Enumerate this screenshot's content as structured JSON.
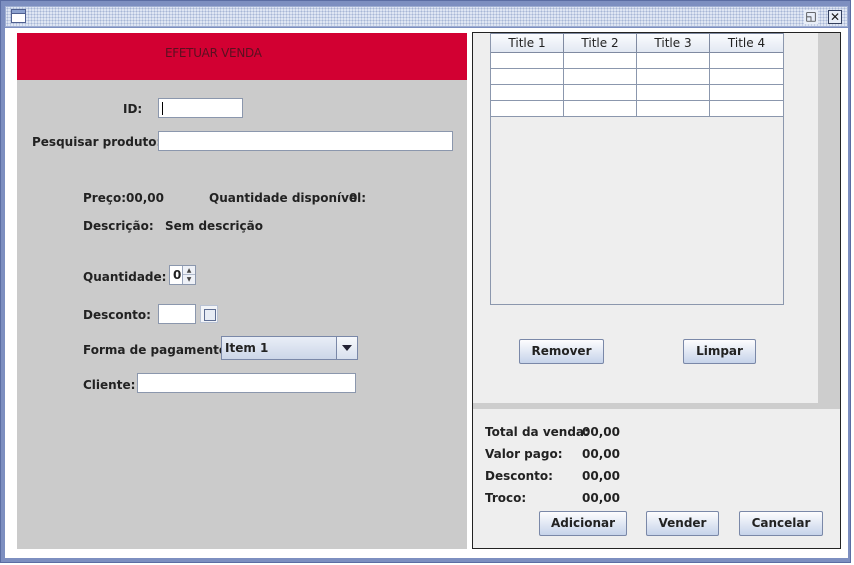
{
  "window": {
    "maximize_glyph": "◱",
    "close_glyph": "✕"
  },
  "sale_form": {
    "header": "EFETUAR VENDA",
    "id_label": "ID:",
    "id_value": "",
    "search_label": "Pesquisar produto:",
    "search_value": "",
    "price_label": "Preço:",
    "price_value": "00,00",
    "qty_available_label": "Quantidade disponível:",
    "qty_available_value": "0",
    "description_label": "Descrição:",
    "description_value": "Sem descrição",
    "quantity_label": "Quantidade:",
    "quantity_value": "0",
    "discount_label": "Desconto:",
    "discount_value": "",
    "payment_label": "Forma de pagamento",
    "payment_selected": "Item 1",
    "client_label": "Cliente:",
    "client_value": ""
  },
  "items_table": {
    "columns": [
      "Title 1",
      "Title 2",
      "Title 3",
      "Title 4"
    ],
    "rows": [
      [
        "",
        "",
        "",
        ""
      ],
      [
        "",
        "",
        "",
        ""
      ],
      [
        "",
        "",
        "",
        ""
      ],
      [
        "",
        "",
        "",
        ""
      ]
    ]
  },
  "table_actions": {
    "remove_label": "Remover",
    "clear_label": "Limpar"
  },
  "totals": {
    "total_label": "Total da venda:",
    "total_value": "00,00",
    "paid_label": "Valor pago:",
    "paid_value": "00,00",
    "discount_label": "Desconto:",
    "discount_value": "00,00",
    "change_label": "Troco:",
    "change_value": "00,00"
  },
  "actions": {
    "add_label": "Adicionar",
    "sell_label": "Vender",
    "cancel_label": "Cancelar"
  },
  "icons": {
    "window": "window-icon",
    "maximize": "maximize-icon",
    "close": "close-icon",
    "spinner_up": "arrow-up-icon",
    "spinner_down": "arrow-down-icon",
    "combo": "chevron-down-icon"
  },
  "colors": {
    "header_bg": "#d20032",
    "panel_bg": "#cbcbcb",
    "frame": "#7d8fc0"
  }
}
